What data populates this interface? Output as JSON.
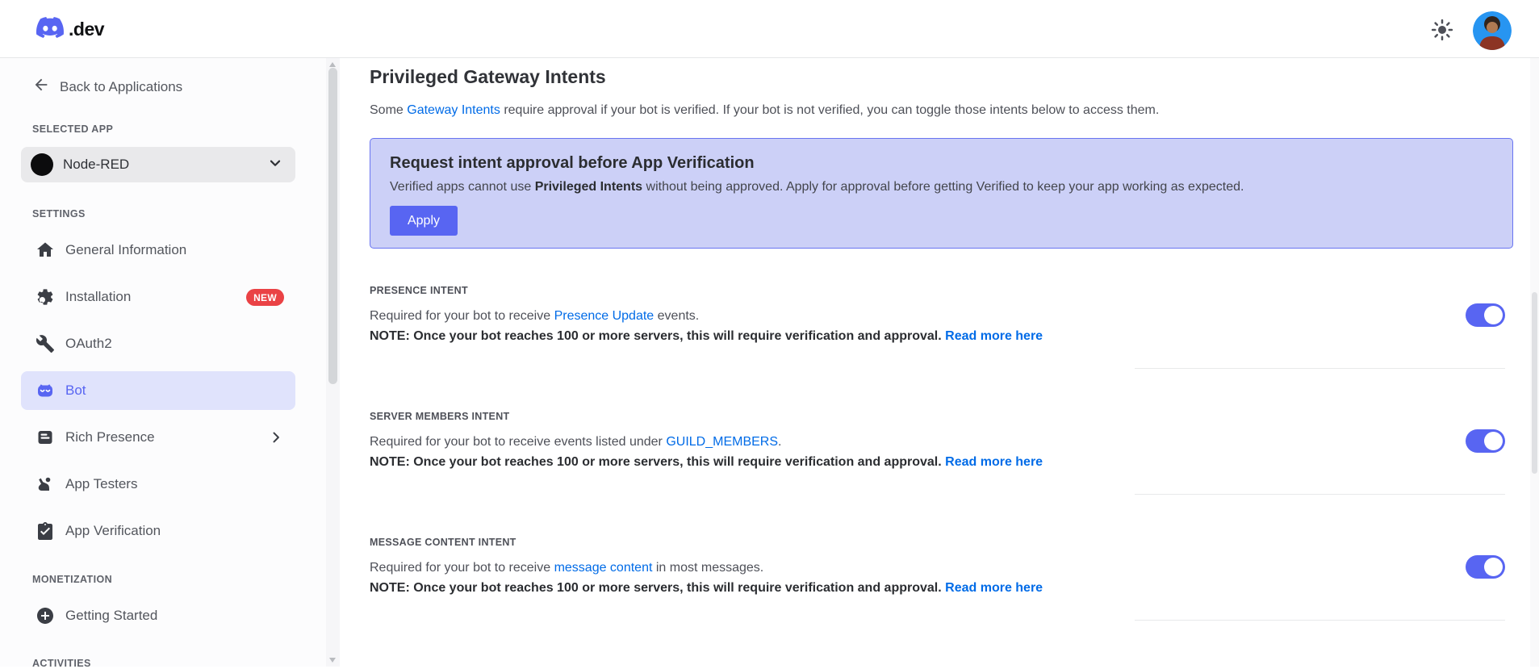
{
  "colors": {
    "blurple": "#5865f2",
    "link_blue": "#006be7",
    "banner_bg": "#ccd0f7",
    "banner_border": "#6874f1",
    "active_item_bg": "#e0e3fc",
    "badge_red": "#ea4245",
    "toggle_on": "#5865f2"
  },
  "header": {
    "logo_suffix": ".dev"
  },
  "sidebar": {
    "back_link": "Back to Applications",
    "selected_app_label": "SELECTED APP",
    "selected_app_name": "Node-RED",
    "sections": [
      {
        "label": "SETTINGS",
        "items": [
          {
            "label": "General Information",
            "icon": "home-icon"
          },
          {
            "label": "Installation",
            "icon": "gear-icon",
            "badge": "NEW"
          },
          {
            "label": "OAuth2",
            "icon": "wrench-icon"
          },
          {
            "label": "Bot",
            "icon": "bot-icon",
            "active": true
          },
          {
            "label": "Rich Presence",
            "icon": "card-list-icon",
            "chevron": true
          },
          {
            "label": "App Testers",
            "icon": "person-raised-hand-icon"
          },
          {
            "label": "App Verification",
            "icon": "clipboard-check-icon"
          }
        ]
      },
      {
        "label": "MONETIZATION",
        "items": [
          {
            "label": "Getting Started",
            "icon": "plus-circle-icon"
          }
        ]
      },
      {
        "label": "ACTIVITIES",
        "items": []
      }
    ]
  },
  "main": {
    "title": "Privileged Gateway Intents",
    "intro": {
      "pre": "Some ",
      "link": "Gateway Intents",
      "post": " require approval if your bot is verified. If your bot is not verified, you can toggle those intents below to access them."
    },
    "banner": {
      "title": "Request intent approval before App Verification",
      "body_pre": "Verified apps cannot use ",
      "body_bold": "Privileged Intents",
      "body_post": " without being approved. Apply for approval before getting Verified to keep your app working as expected.",
      "apply_label": "Apply"
    },
    "intents": [
      {
        "label": "PRESENCE INTENT",
        "desc_pre": "Required for your bot to receive ",
        "desc_link": "Presence Update",
        "desc_post": " events.",
        "note": "NOTE: Once your bot reaches 100 or more servers, this will require verification and approval.",
        "read_more": "Read more here",
        "enabled": true
      },
      {
        "label": "SERVER MEMBERS INTENT",
        "desc_pre": "Required for your bot to receive events listed under ",
        "desc_link": "GUILD_MEMBERS",
        "desc_post": ".",
        "note": "NOTE: Once your bot reaches 100 or more servers, this will require verification and approval.",
        "read_more": "Read more here",
        "enabled": true
      },
      {
        "label": "MESSAGE CONTENT INTENT",
        "desc_pre": "Required for your bot to receive ",
        "desc_link": "message content",
        "desc_post": " in most messages.",
        "note": "NOTE: Once your bot reaches 100 or more servers, this will require verification and approval.",
        "read_more": "Read more here",
        "enabled": true
      }
    ]
  }
}
